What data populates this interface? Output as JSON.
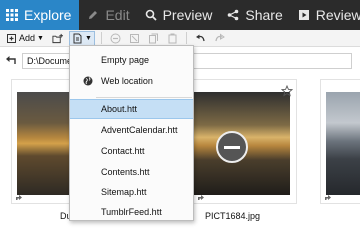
{
  "tabs": [
    {
      "label": "Explore",
      "icon": "grid-icon"
    },
    {
      "label": "Edit",
      "icon": "pencil-icon"
    },
    {
      "label": "Preview",
      "icon": "magnifier-icon"
    },
    {
      "label": "Share",
      "icon": "share-icon"
    },
    {
      "label": "Review",
      "icon": "play-icon"
    }
  ],
  "toolbar": {
    "add_label": "Add",
    "caret": "▼"
  },
  "address": {
    "path": "D:\\Documen"
  },
  "menu": {
    "items": [
      {
        "label": "Empty page"
      },
      {
        "label": "Web location"
      },
      {
        "label": "About.htt"
      },
      {
        "label": "AdventCalendar.htt"
      },
      {
        "label": "Contact.htt"
      },
      {
        "label": "Contents.htt"
      },
      {
        "label": "Sitemap.htt"
      },
      {
        "label": "TumblrFeed.htt"
      }
    ],
    "highlighted": "About.htt"
  },
  "files": [
    {
      "name": "Du"
    },
    {
      "name": "PICT1684.jpg"
    }
  ],
  "colors": {
    "accent": "#2a86c8",
    "ribbon": "#2b2b2b",
    "highlight": "#c5dff5"
  }
}
